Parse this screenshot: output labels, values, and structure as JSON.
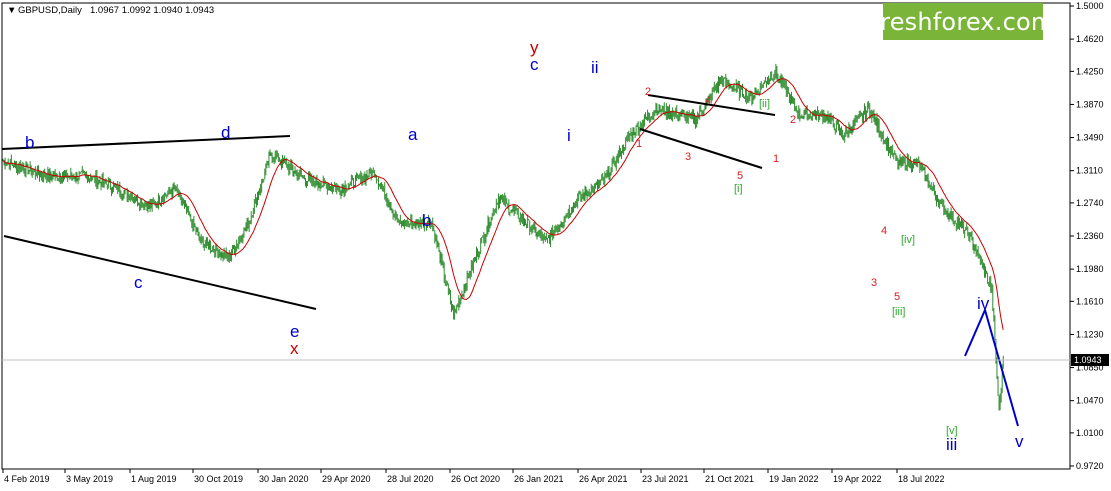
{
  "header": {
    "symbol": "GBPUSD,Daily",
    "ohlc": "1.0967 1.0992 1.0940 1.0943"
  },
  "logo": {
    "text": "freshforex.com"
  },
  "price_tag": "1.0943",
  "y_ticks": [
    "1.5000",
    "1.4620",
    "1.4250",
    "1.3870",
    "1.3490",
    "1.3110",
    "1.2740",
    "1.2360",
    "1.1980",
    "1.1610",
    "1.1230",
    "1.0850",
    "1.0470",
    "1.0100",
    "0.9720"
  ],
  "x_ticks": [
    "4 Feb 2019",
    "3 May 2019",
    "1 Aug 2019",
    "30 Oct 2019",
    "30 Jan 2020",
    "29 Apr 2020",
    "28 Jul 2020",
    "26 Oct 2020",
    "26 Jan 2021",
    "26 Apr 2021",
    "23 Jul 2021",
    "21 Oct 2021",
    "19 Jan 2022",
    "19 Apr 2022",
    "18 Jul 2022"
  ],
  "colors": {
    "candles": "#2e8b2e",
    "ma": "#cc0000",
    "blue": "#0000cc",
    "red": "#cc0000",
    "green": "#2fa82f",
    "dred": "#d22020"
  },
  "chart_data": {
    "type": "line",
    "ylim": [
      0.972,
      1.5
    ],
    "series": [
      {
        "x_index": [
          0,
          40,
          80,
          110,
          140,
          165,
          190,
          216,
          235,
          257,
          292,
          324,
          356,
          380,
          411,
          432,
          475,
          521,
          552,
          577,
          600,
          626,
          664,
          688,
          717,
          740,
          764,
          788,
          806,
          830,
          857,
          877,
          900,
          926,
          948,
          955,
          959
        ],
        "values": [
          1.322,
          1.305,
          1.305,
          1.29,
          1.27,
          1.29,
          1.23,
          1.21,
          1.25,
          1.33,
          1.3,
          1.29,
          1.31,
          1.25,
          1.252,
          1.145,
          1.28,
          1.23,
          1.28,
          1.3,
          1.35,
          1.382,
          1.37,
          1.415,
          1.395,
          1.425,
          1.375,
          1.375,
          1.352,
          1.382,
          1.32,
          1.32,
          1.27,
          1.238,
          1.175,
          1.034,
          1.096
        ]
      }
    ]
  },
  "waves": {
    "black": [
      {
        "t": "b",
        "c": "blue",
        "k": "big"
      },
      {
        "t": "c",
        "c": "blue",
        "k": "big"
      },
      {
        "t": "d",
        "c": "blue",
        "k": "big"
      },
      {
        "t": "e",
        "c": "blue",
        "k": "big"
      },
      {
        "t": "x",
        "c": "red",
        "k": "big"
      },
      {
        "t": "a",
        "c": "blue",
        "k": "big"
      },
      {
        "t": "b",
        "c": "blue",
        "k": "big"
      },
      {
        "t": "y",
        "c": "red",
        "k": "big"
      },
      {
        "t": "c",
        "c": "blue",
        "k": "big"
      },
      {
        "t": "i",
        "c": "blue",
        "k": "big"
      },
      {
        "t": "ii",
        "c": "blue",
        "k": "big"
      },
      {
        "t": "1",
        "c": "dred",
        "k": "sml"
      },
      {
        "t": "2",
        "c": "dred",
        "k": "sml"
      },
      {
        "t": "3",
        "c": "dred",
        "k": "sml"
      },
      {
        "t": "4",
        "c": "dred",
        "k": "sml"
      },
      {
        "t": "5",
        "c": "dred",
        "k": "sml"
      },
      {
        "t": "[i]",
        "c": "green",
        "k": "sml"
      },
      {
        "t": "[ii]",
        "c": "green",
        "k": "sml"
      },
      {
        "t": "1",
        "c": "dred",
        "k": "sml"
      },
      {
        "t": "2",
        "c": "dred",
        "k": "sml"
      },
      {
        "t": "3",
        "c": "dred",
        "k": "sml"
      },
      {
        "t": "4",
        "c": "dred",
        "k": "sml"
      },
      {
        "t": "5",
        "c": "dred",
        "k": "sml"
      },
      {
        "t": "[iii]",
        "c": "green",
        "k": "sml"
      },
      {
        "t": "[iv]",
        "c": "green",
        "k": "sml"
      },
      {
        "t": "[v]",
        "c": "green",
        "k": "sml"
      },
      {
        "t": "iii",
        "c": "blue",
        "k": "big"
      },
      {
        "t": "iv",
        "c": "blue",
        "k": "big"
      },
      {
        "t": "v",
        "c": "blue",
        "k": "big"
      }
    ]
  }
}
